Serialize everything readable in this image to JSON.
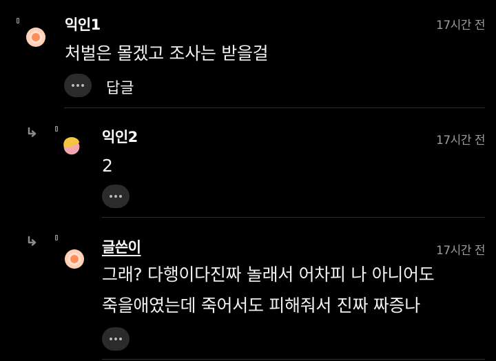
{
  "comments": [
    {
      "nickname": "익인1",
      "time": "17시간 전",
      "text": "처벌은 몰겠고 조사는 받을걸",
      "reply_label": "답글",
      "avatar_icon": "orange-circle-avatar",
      "is_reply": false
    },
    {
      "nickname": "익인2",
      "time": "17시간 전",
      "text": "2",
      "avatar_icon": "moon-avatar",
      "is_reply": true
    },
    {
      "nickname": "글쓴이",
      "time": "17시간 전",
      "text_lines": [
        "그래? 다행이다진짜 놀래서 어차피 나 아니어도",
        "죽을애였는데 죽어서도 피해줘서 진짜 짜증나"
      ],
      "avatar_icon": "orange-circle-avatar",
      "is_reply": true
    }
  ],
  "colors": {
    "background": "#000000",
    "time_text": "#9c9c9c",
    "more_button": "#2b2b2b",
    "avatar_orange": "#ff8d5a",
    "avatar_yellow": "#f4c542",
    "avatar_pink": "#f4a7b0"
  }
}
